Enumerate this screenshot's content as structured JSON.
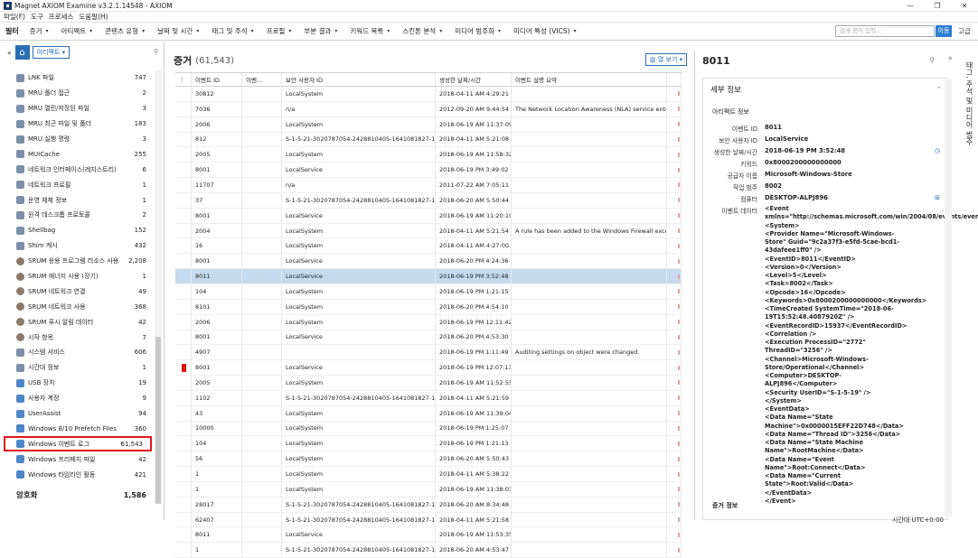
{
  "window": {
    "title": "Magnet AXIOM Examine v3.2.1.14548 - AXIOM",
    "controls": [
      "—",
      "❐",
      "✕"
    ]
  },
  "menu": [
    "파일(F)",
    "도구",
    "프로세스",
    "도움말(H)"
  ],
  "filterbar": {
    "title": "필터",
    "buttons": [
      "증거",
      "아티팩트",
      "콘텐츠 유형",
      "날짜 및 시간",
      "태그 및 주석",
      "프로필",
      "부분 결과",
      "키워드 목록",
      "스킨톤 분석",
      "미디어 범주화",
      "미디어 특성 (VICS)"
    ],
    "search_placeholder": "검색 용어 입력...",
    "go": "이동",
    "advanced": "고급"
  },
  "left": {
    "dropdown": "아티팩트",
    "items": [
      {
        "label": "LNK 파일",
        "count": "747"
      },
      {
        "label": "MRU 폴더 접근",
        "count": "2"
      },
      {
        "label": "MRU 열린/저장된 파일",
        "count": "3"
      },
      {
        "label": "MRU 최근 파일 및 폴더",
        "count": "183"
      },
      {
        "label": "MRU 실행 명령",
        "count": "3"
      },
      {
        "label": "MUICache",
        "count": "255"
      },
      {
        "label": "네트워크 인터페이스(레지스트리)",
        "count": "6"
      },
      {
        "label": "네트워크 프로필",
        "count": "1"
      },
      {
        "label": "운영 체제 정보",
        "count": "1"
      },
      {
        "label": "원격 데스크톱 프로토콜",
        "count": "2"
      },
      {
        "label": "Shellbag",
        "count": "152"
      },
      {
        "label": "Shim 캐시",
        "count": "432"
      },
      {
        "label": "SRUM 응용 프로그램 리소스 사용",
        "count": "2,208"
      },
      {
        "label": "SRUM 에너지 사용 (장기)",
        "count": "1"
      },
      {
        "label": "SRUM 네트워크 연결",
        "count": "49"
      },
      {
        "label": "SRUM 네트워크 사용",
        "count": "368"
      },
      {
        "label": "SRUM 푸시 알림 데이터",
        "count": "42"
      },
      {
        "label": "시작 항목",
        "count": "7"
      },
      {
        "label": "시스템 서비스",
        "count": "606"
      },
      {
        "label": "시간대 정보",
        "count": "1"
      },
      {
        "label": "USB 장치",
        "count": "19"
      },
      {
        "label": "사용자 계정",
        "count": "9"
      },
      {
        "label": "UserAssist",
        "count": "94"
      },
      {
        "label": "Windows 8/10 Prefetch Files",
        "count": "360"
      },
      {
        "label": "Windows 이벤트 로그",
        "count": "61,543"
      },
      {
        "label": "Windows 프리페치 파일",
        "count": "42"
      },
      {
        "label": "Windows 타임라인 활동",
        "count": "421"
      }
    ],
    "category": {
      "label": "암호화",
      "count": "1,586"
    }
  },
  "middle": {
    "title": "증거",
    "count": "(61,543)",
    "column_view": "열 보기",
    "headers": [
      "이벤트 ID",
      "이벤...",
      "보안 사용자 ID",
      "생성한 날짜/시간",
      "이벤트 설명 요약"
    ],
    "rows": [
      [
        "30812",
        "",
        "LocalSystem",
        "2018-04-11 AM 4:29:21",
        ""
      ],
      [
        "7036",
        "",
        "n/a",
        "2012-09-20 AM 9:44:54",
        "The Network Location Awareness (NLA) service ente..."
      ],
      [
        "2006",
        "",
        "LocalSystem",
        "2018-06-19 AM 11:37:09",
        ""
      ],
      [
        "812",
        "",
        "S-1-5-21-3020787054-2428810405-1641081827-1001",
        "2018-04-11 AM 5:21:08",
        ""
      ],
      [
        "2005",
        "",
        "LocalSystem",
        "2018-06-19 AM 11:58:32",
        ""
      ],
      [
        "8001",
        "",
        "LocalService",
        "2018-06-19 PM 3:49:02",
        ""
      ],
      [
        "11707",
        "",
        "n/a",
        "2011-07-22 AM 7:05:11",
        ""
      ],
      [
        "37",
        "",
        "S-1-5-21-3020787054-2428810405-1641081827-1001",
        "2018-06-20 AM 5:50:44",
        ""
      ],
      [
        "8001",
        "",
        "LocalService",
        "2018-06-19 AM 11:20:19",
        ""
      ],
      [
        "2004",
        "",
        "LocalSystem",
        "2018-04-11 AM 5:21:54",
        "A rule has been added to the Windows Firewall exce..."
      ],
      [
        "16",
        "",
        "LocalSystem",
        "2018-04-11 AM 4:27:00",
        ""
      ],
      [
        "8001",
        "",
        "LocalService",
        "2018-06-20 PM 4:24:36",
        ""
      ],
      [
        "8011",
        "",
        "LocalService",
        "2018-06-19 PM 3:52:48",
        ""
      ],
      [
        "104",
        "",
        "LocalSystem",
        "2018-06-19 PM 1:21:15",
        ""
      ],
      [
        "8101",
        "",
        "LocalSystem",
        "2018-06-20 PM 4:54:10",
        ""
      ],
      [
        "2006",
        "",
        "LocalSystem",
        "2018-06-19 PM 12:11:42",
        ""
      ],
      [
        "8001",
        "",
        "LocalService",
        "2018-06-20 PM 4:53:30",
        ""
      ],
      [
        "4907",
        "",
        "",
        "2018-06-19 PM 1:11:49",
        "Auditing settings on object were changed."
      ],
      [
        "8001",
        "",
        "LocalService",
        "2018-06-19 PM 12:07:13",
        ""
      ],
      [
        "2005",
        "",
        "LocalSystem",
        "2018-06-19 AM 11:52:55",
        ""
      ],
      [
        "1102",
        "",
        "S-1-5-21-3020787054-2428810405-1641081827-1001",
        "2018-04-11 AM 5:21:59",
        ""
      ],
      [
        "43",
        "",
        "LocalSystem",
        "2018-06-19 AM 11:39:04",
        ""
      ],
      [
        "10000",
        "",
        "LocalSystem",
        "2018-06-19 PM 1:25:07",
        ""
      ],
      [
        "104",
        "",
        "LocalSystem",
        "2018-06-19 PM 1:21:13",
        ""
      ],
      [
        "56",
        "",
        "LocalSystem",
        "2018-06-20 AM 5:50:43",
        ""
      ],
      [
        "1",
        "",
        "LocalSystem",
        "2018-04-11 AM 5:38:22",
        ""
      ],
      [
        "1",
        "",
        "LocalSystem",
        "2018-06-19 AM 11:38:03",
        ""
      ],
      [
        "28017",
        "",
        "S-1-5-21-3020787054-2428810405-1641081827-1001",
        "2018-06-20 AM 8:34:48",
        ""
      ],
      [
        "62407",
        "",
        "S-1-5-21-3020787054-2428810405-1641081827-1000",
        "2018-04-11 AM 5:21:58",
        ""
      ],
      [
        "8011",
        "",
        "LocalService",
        "2018-06-19 AM 11:53:35",
        ""
      ],
      [
        "1",
        "",
        "S-1-5-21-3020787054-2428810405-1641081827-1003",
        "2018-06-20 AM 4:53:47",
        ""
      ]
    ],
    "selected_index": 12,
    "flag_index": 18
  },
  "right": {
    "title": "8011",
    "section": "세부 정보",
    "subsection": "아티팩트 정보",
    "fields": [
      {
        "k": "이벤트 ID",
        "v": "8011"
      },
      {
        "k": "보안 사용자 ID",
        "v": "LocalService"
      },
      {
        "k": "생성한 날짜/시간",
        "v": "2018-06-19 PM 3:52:48"
      },
      {
        "k": "키워드",
        "v": "0x8000200000000000"
      },
      {
        "k": "공급자 이름",
        "v": "Microsoft-Windows-Store"
      },
      {
        "k": "작업 범주",
        "v": "8002"
      },
      {
        "k": "컴퓨터",
        "v": "DESKTOP-ALPJ896"
      }
    ],
    "event_data_label": "이벤트 데이터",
    "event_data": "<Event xmlns=\"http://schemas.microsoft.com/win/2004/08/events/event\">\n<System>\n<Provider Name=\"Microsoft-Windows-Store\" Guid=\"9c2a37f3-e5fd-5cae-bcd1-43dafeee1ff0\" />\n<EventID>8011</EventID>\n<Version>0</Version>\n<Level>5</Level>\n<Task>8002</Task>\n<Opcode>16</Opcode>\n<Keywords>0x8000200000000000</Keywords>\n<TimeCreated SystemTime=\"2018-06-19T15:52:48.4087920Z\" />\n<EventRecordID>15937</EventRecordID>\n<Correlation />\n<Execution ProcessID=\"2772\" ThreadID=\"3256\" />\n<Channel>Microsoft-Windows-Store/Operational</Channel>\n<Computer>DESKTOP-ALPJ896</Computer>\n<Security UserID=\"S-1-5-19\" />\n</System>\n<EventData>\n<Data Name=\"State Machine\">0x0000015EFF22D748</Data>\n<Data Name=\"Thread ID\">3256</Data>\n<Data Name=\"State Machine Name\">RootMachine</Data>\n<Data Name=\"Event Name\">Root:Connect</Data>\n<Data Name=\"Current State\">Root:Valid</Data>\n</EventData>\n</Event>",
    "footer_section": "증거 정보",
    "side_panel": "태그, 주석 및 미디어 범주"
  },
  "status": "시간대  UTC+0:00"
}
